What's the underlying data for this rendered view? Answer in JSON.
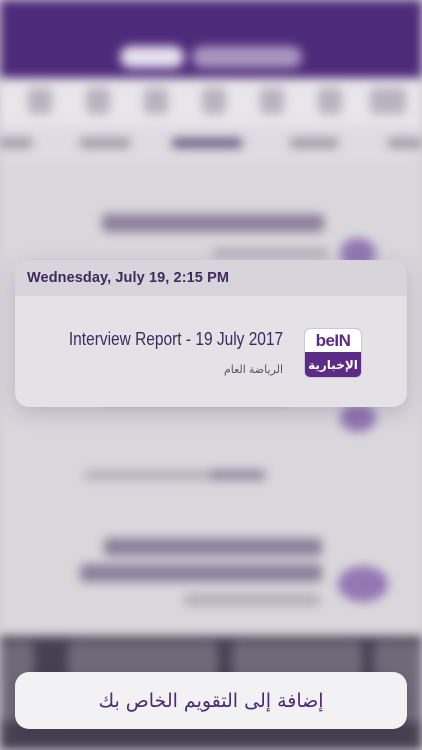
{
  "preview": {
    "date_time": "Wednesday, July 19, 2:15 PM",
    "event_title": "Interview Report - 19 July 2017",
    "event_category": "الرياضة العام",
    "logo": {
      "icon": "bein-news-logo",
      "brand_text": "beIN",
      "sub_text": "الإخبارية"
    }
  },
  "action": {
    "add_to_calendar_label": "إضافة إلى التقويم الخاص بك"
  },
  "colors": {
    "brand_purple": "#4e2a7a",
    "logo_purple": "#5b2b86",
    "text_dark": "#3e2a5c"
  }
}
